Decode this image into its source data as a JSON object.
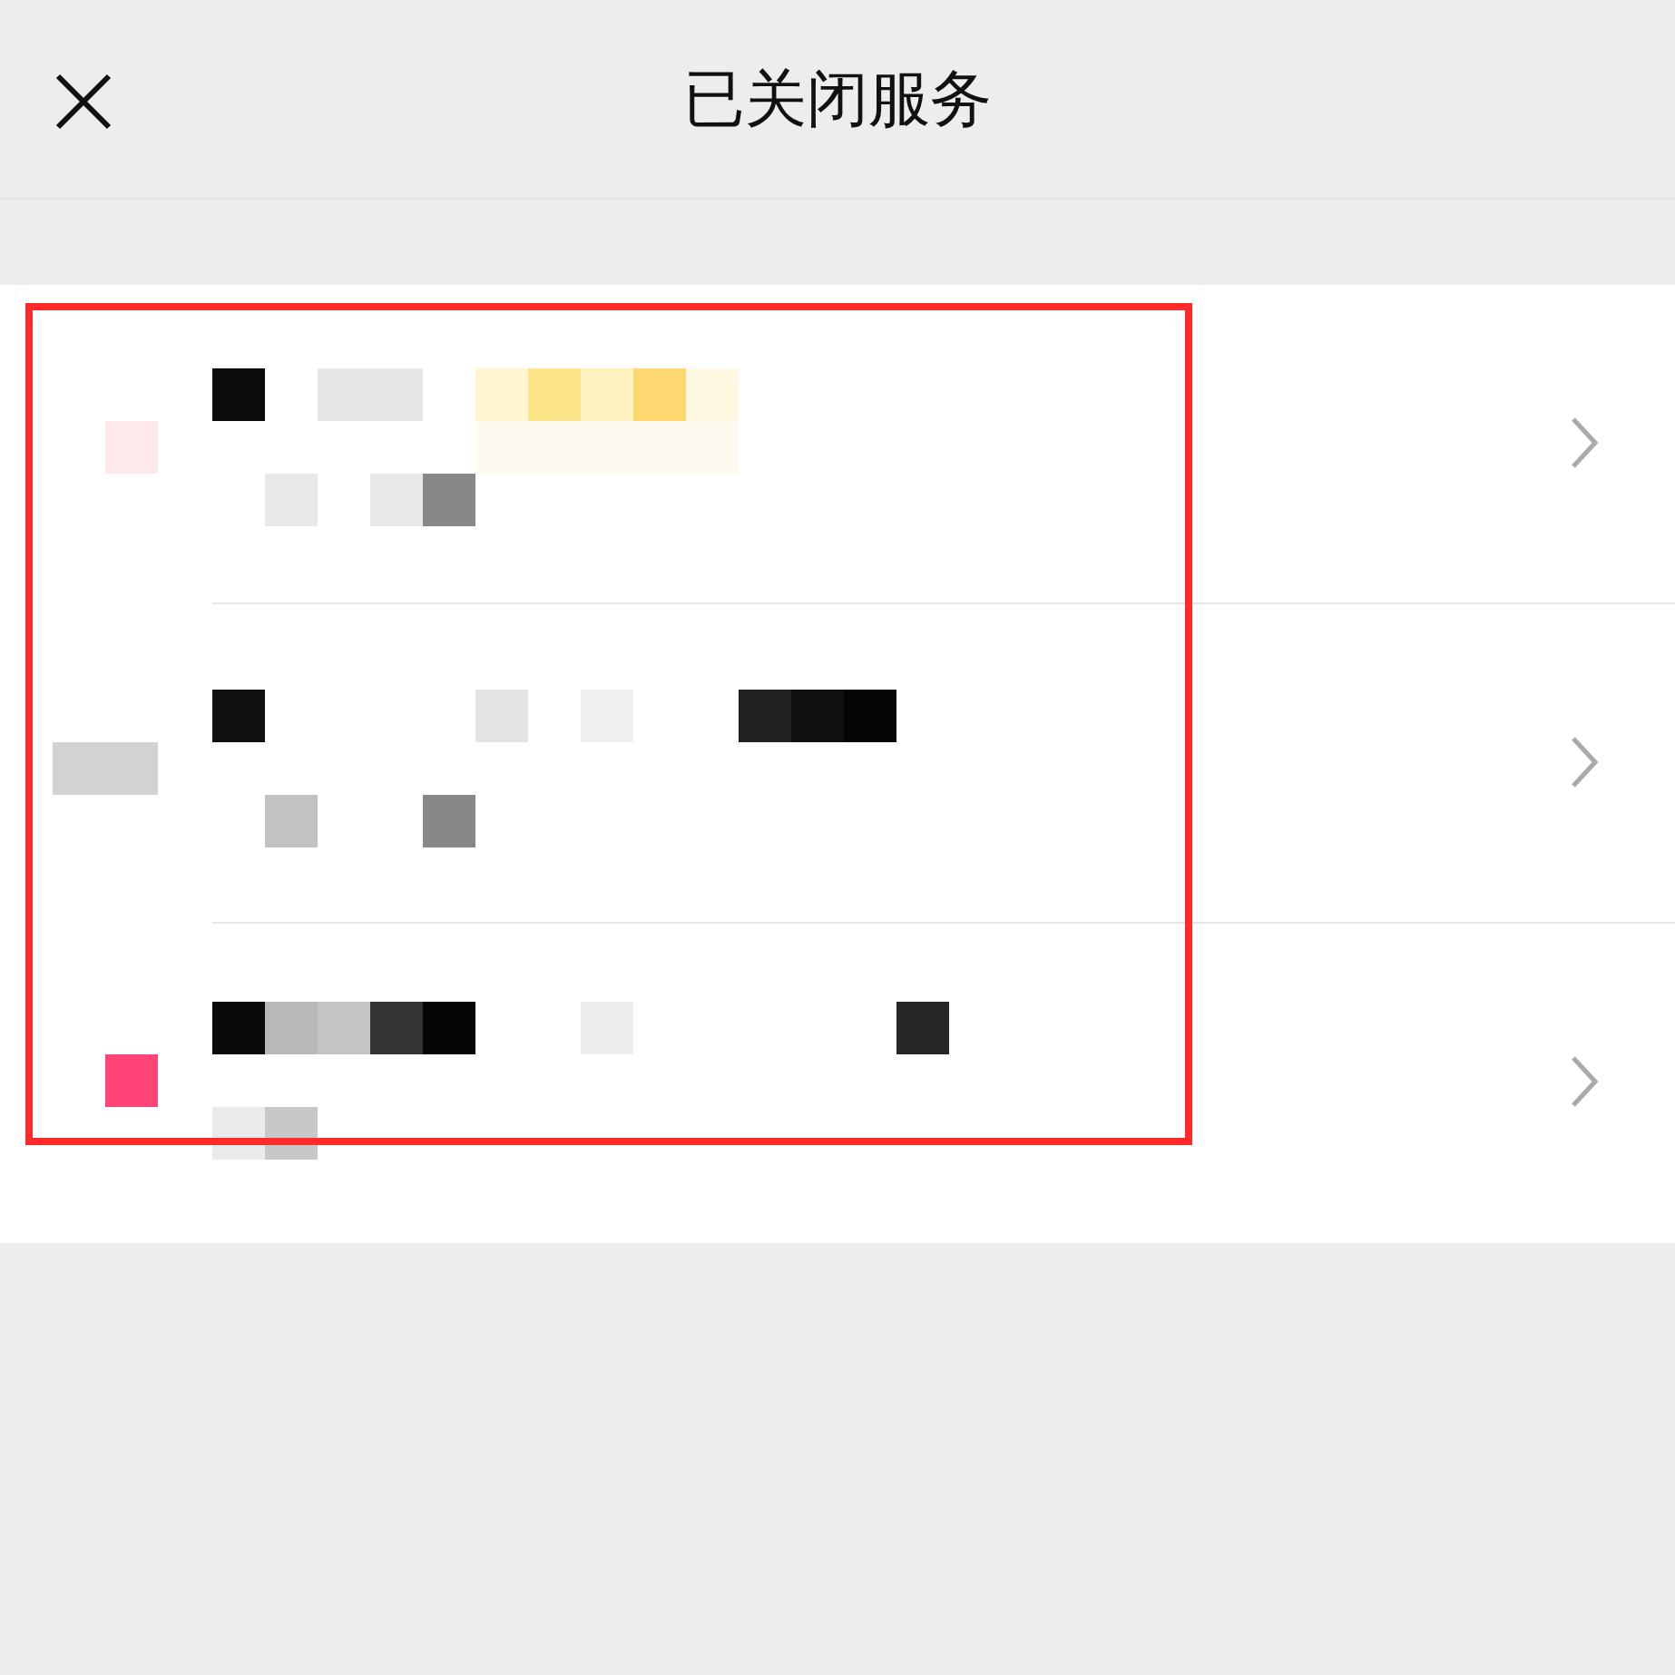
{
  "header": {
    "title": "已关闭服务"
  },
  "services": [
    {
      "kind": "pixelated"
    },
    {
      "kind": "pixelated"
    },
    {
      "kind": "pixelated"
    }
  ],
  "annotation": {
    "kind": "highlight-frame"
  }
}
